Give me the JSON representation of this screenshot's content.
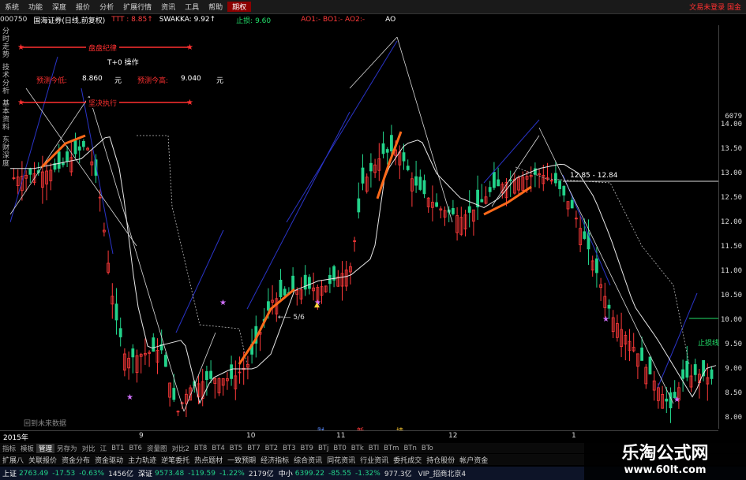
{
  "menubar": {
    "items": [
      "系统",
      "功能",
      "深度",
      "报价",
      "分析",
      "扩展行情",
      "资讯",
      "工具",
      "帮助",
      "期权"
    ],
    "active_index": 9,
    "right": "文易未登录  国金"
  },
  "infobar": {
    "code": "000750",
    "name": "国海证券(日线,前复权)",
    "ttt": "TTT : 8.85↑",
    "swakka": "SWAKKA: 9.92↑",
    "stop": "止损: 9.60",
    "ao": "AO1:- BO1:- AO2:-",
    "ao_end": "AO"
  },
  "sidetabs": [
    "分时走势",
    "技术分析",
    "基本资料",
    "东财深度"
  ],
  "tbox": {
    "top_banner": "盘盘纪律",
    "title": "T+0 操作",
    "low_label": "预测今低:",
    "low_value": "8.860",
    "high_label": "预测今高:",
    "high_value": "9.040",
    "unit": "元",
    "bottom_banner": "坚决执行"
  },
  "chart_labels": {
    "range": "12.85 - 12.84",
    "stop_right": "止损线",
    "arrow_text": "←— 5/6",
    "no_data": "回到未来数据",
    "cai": "财",
    "xin": "新",
    "chi": "持"
  },
  "yaxis": {
    "ticks": [
      "6079",
      "14.00",
      "13.50",
      "13.00",
      "12.50",
      "12.00",
      "11.50",
      "11.00",
      "10.50",
      "10.00",
      "9.50",
      "9.00",
      "8.50",
      "8.00"
    ]
  },
  "xaxis": {
    "labels": [
      "2015年",
      "9",
      "10",
      "11",
      "12",
      "1"
    ]
  },
  "tabs_row1": [
    "指标",
    "模板",
    "管理",
    "另存为",
    "对比",
    "江",
    "BT1",
    "BT6",
    "资量图",
    "对比2",
    "BT8",
    "BT4",
    "BT5",
    "BT7",
    "BT2",
    "BT3",
    "BT9",
    "BTj",
    "BT0",
    "BTk",
    "BTl",
    "BTm",
    "BTn",
    "BTo"
  ],
  "tabs_row1_selected": 2,
  "tabs_row2": [
    "扩展八",
    "关联报价",
    "资金分布",
    "资金驱动",
    "主力轨迹",
    "逆笔委托",
    "热点题材",
    "一致预期",
    "经济指标",
    "综合资讯",
    "同花资讯",
    "行业资讯",
    "委托成交",
    "持仓股份",
    "帐户资金"
  ],
  "statusbar": {
    "sh_label": "上证",
    "sh_value": "2763.49",
    "sh_change": "-17.53",
    "sh_pct": "-0.63%",
    "sh_vol": "1456亿",
    "sz_label": "深证",
    "sz_value": "9573.48",
    "sz_change": "-119.59",
    "sz_pct": "-1.22%",
    "sz_vol": "2179亿",
    "zx_label": "中小",
    "zx_value": "6399.22",
    "zx_change": "-85.55",
    "zx_pct": "-1.32%",
    "zx_vol": "977.3亿",
    "vip": "VIP_招商北京4"
  },
  "watermark": {
    "line1": "乐淘公式网",
    "line2": "www.60lt.com"
  },
  "colors": {
    "up": "#ff3a3a",
    "down": "#22d38a",
    "orange": "#ff6a1a",
    "blue": "#2a34c8",
    "white": "#e8e8e8"
  }
}
